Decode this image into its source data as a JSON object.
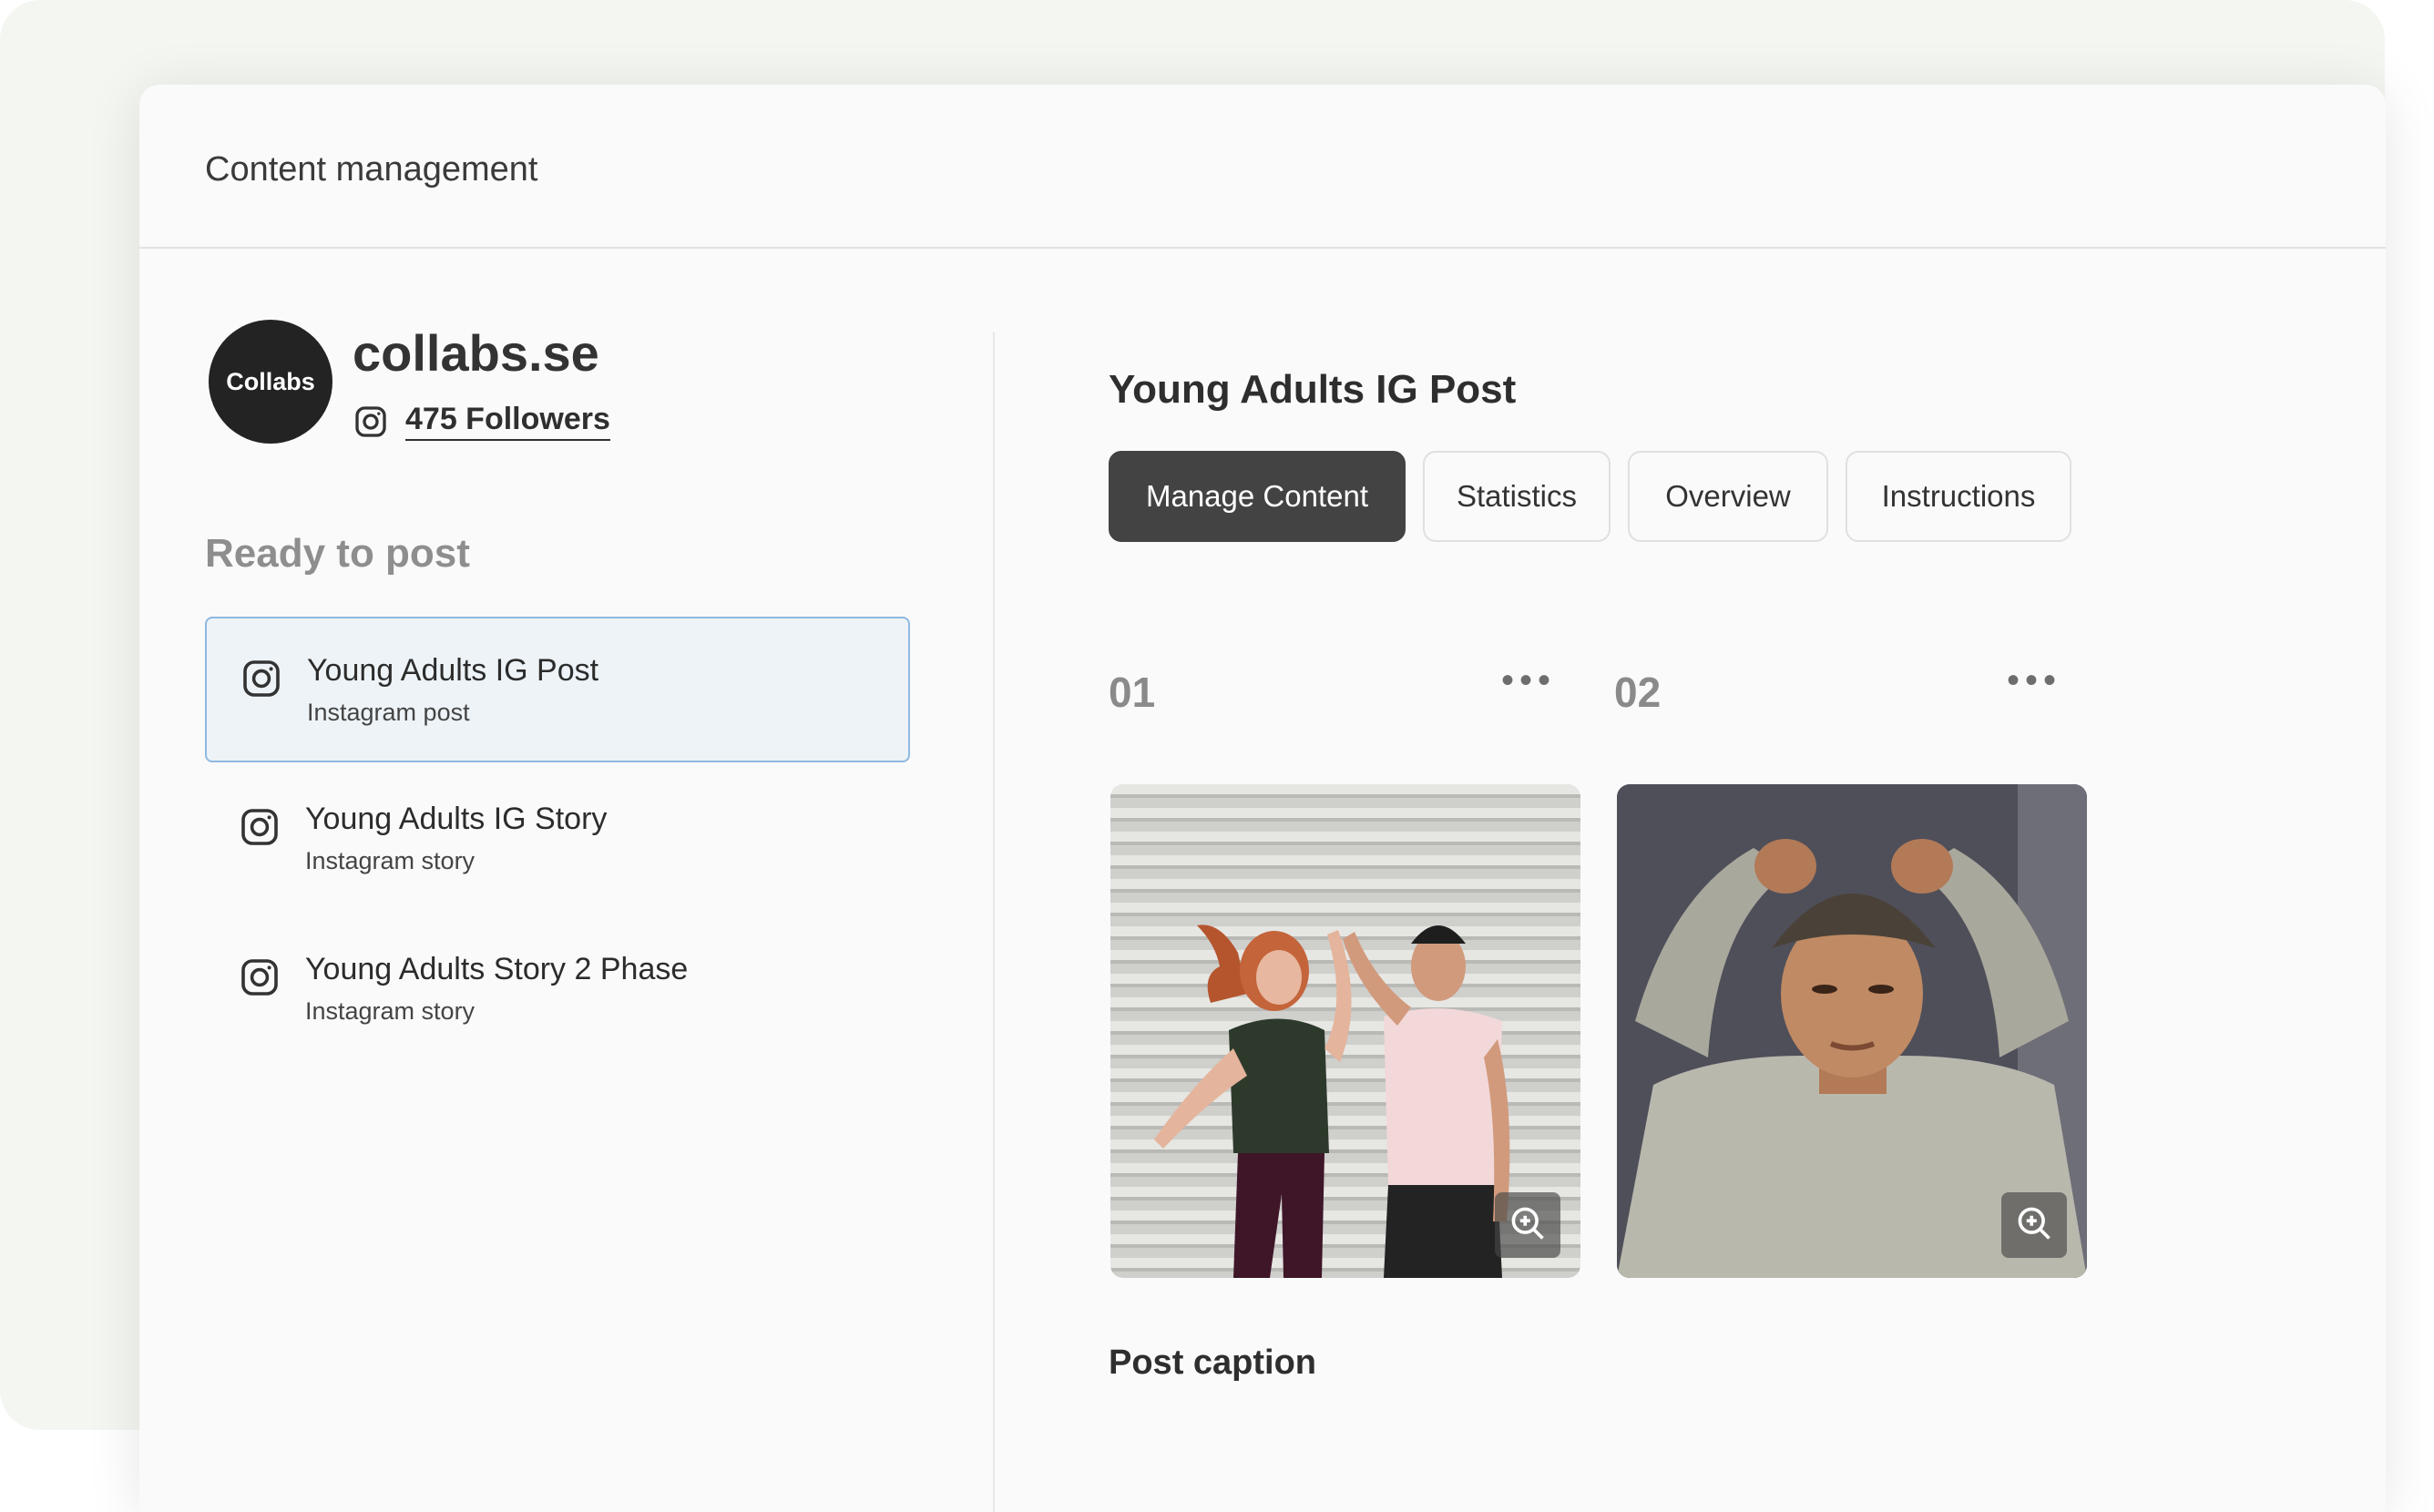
{
  "header": {
    "title": "Content management"
  },
  "profile": {
    "avatar_text": "Collabs",
    "name": "collabs.se",
    "followers": "475 Followers"
  },
  "sidebar": {
    "section_title": "Ready to post",
    "items": [
      {
        "title": "Young Adults IG Post",
        "subtitle": "Instagram post",
        "selected": true,
        "icon": "instagram-icon"
      },
      {
        "title": "Young Adults IG Story",
        "subtitle": "Instagram story",
        "selected": false,
        "icon": "instagram-icon"
      },
      {
        "title": "Young Adults Story 2 Phase",
        "subtitle": "Instagram story",
        "selected": false,
        "icon": "instagram-icon"
      }
    ]
  },
  "main": {
    "title": "Young Adults IG Post",
    "tabs": [
      {
        "label": "Manage Content",
        "active": true
      },
      {
        "label": "Statistics",
        "active": false
      },
      {
        "label": "Overview",
        "active": false
      },
      {
        "label": "Instructions",
        "active": false
      }
    ],
    "media": [
      {
        "number": "01",
        "menu": "•••",
        "icon": "zoom-in-icon"
      },
      {
        "number": "02",
        "menu": "•••",
        "icon": "zoom-in-icon"
      }
    ],
    "caption_title": "Post caption"
  },
  "colors": {
    "active_tab": "#434343",
    "selected_item_bg": "#edf3f6",
    "selected_item_border": "#8fb9e2",
    "avatar_bg": "#232323"
  }
}
